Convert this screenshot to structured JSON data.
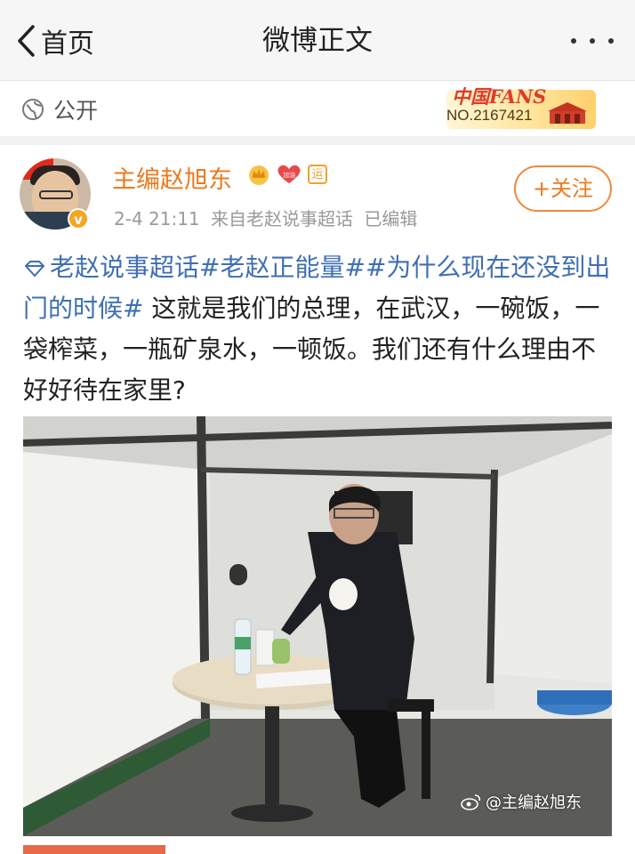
{
  "nav": {
    "back_label": "首页",
    "title": "微博正文"
  },
  "visibility": {
    "label": "公开"
  },
  "fans_badge": {
    "brand": "中国FANS",
    "number": "NO.2167421"
  },
  "post": {
    "author": "主编赵旭东",
    "badge_text": "运",
    "time": "2-4 21:11",
    "source": "来自老赵说事超话",
    "edited": "已编辑",
    "follow_label": "+关注",
    "tags": [
      "老赵说事超话",
      "#老赵正能量#",
      "#为什么现在还没到出门的时候#"
    ],
    "text": " 这就是我们的总理，在武汉，一碗饭，一袋榨菜，一瓶矿泉水，一顿饭。我们还有什么理由不好好待在家里?",
    "image_watermark": "@主编赵旭东"
  },
  "colors": {
    "accent_orange": "#ec7a1e",
    "link_blue": "#3f6fb5",
    "nav_bg": "#f6f6f6"
  },
  "icons": [
    "back-chevron-icon",
    "more-dots-icon",
    "globe-icon",
    "crown-icon",
    "heart-icon",
    "super-topic-icon",
    "weibo-logo-icon"
  ]
}
